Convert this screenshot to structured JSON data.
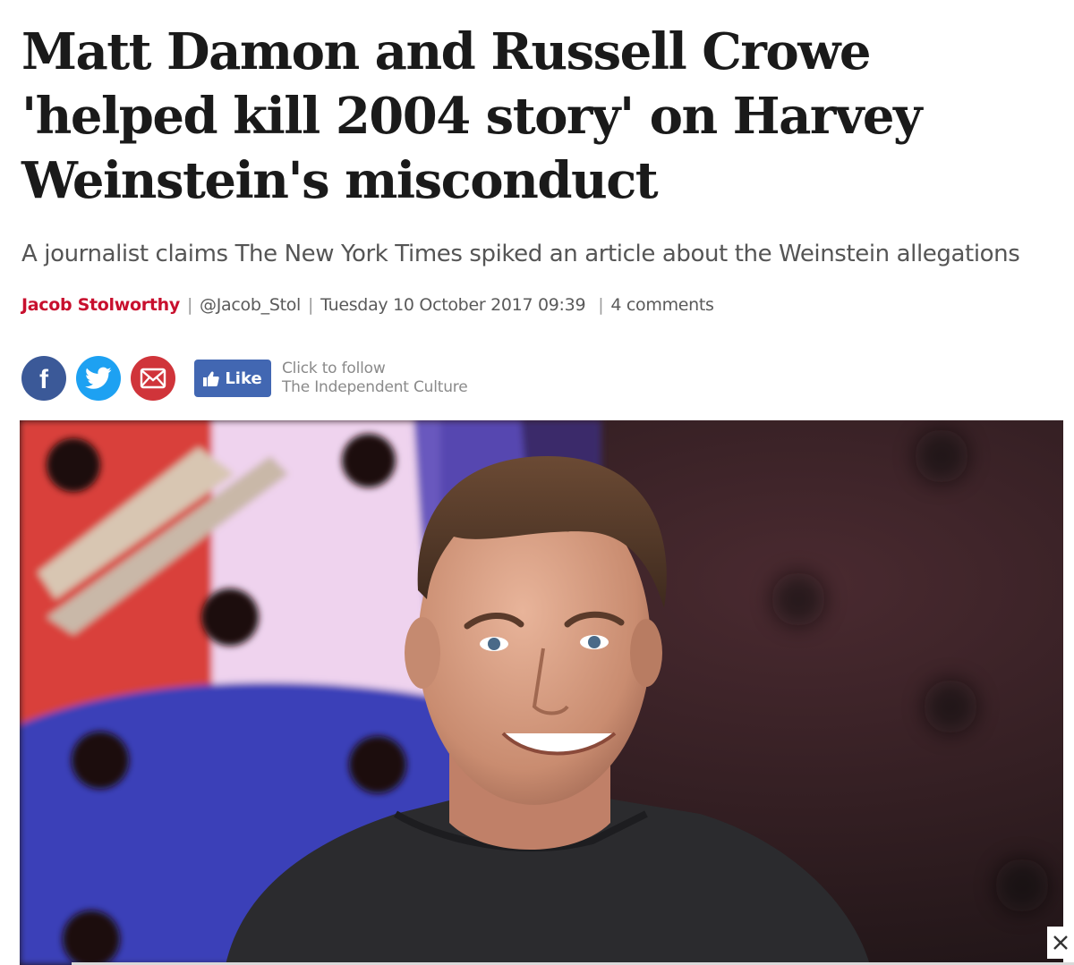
{
  "article": {
    "headline": "Matt Damon and Russell Crowe 'helped kill 2004 story' on Harvey Weinstein's misconduct",
    "standfirst": "A journalist claims The New York Times spiked an article about the Weinstein allegations",
    "byline": {
      "author": "Jacob Stolworthy",
      "handle": "@Jacob_Stol",
      "datetime": "Tuesday 10 October 2017 09:39",
      "comments": "4 comments"
    }
  },
  "share": {
    "facebook_icon": "facebook-icon",
    "twitter_icon": "twitter-icon",
    "email_icon": "email-icon",
    "like_label": "Like",
    "follow_line1": "Click to follow",
    "follow_line2": "The Independent Culture"
  },
  "colors": {
    "author_red": "#c8102e",
    "facebook_blue": "#3b5998",
    "twitter_blue": "#1da1f2",
    "email_red": "#d0343a",
    "like_blue": "#4267b2"
  }
}
